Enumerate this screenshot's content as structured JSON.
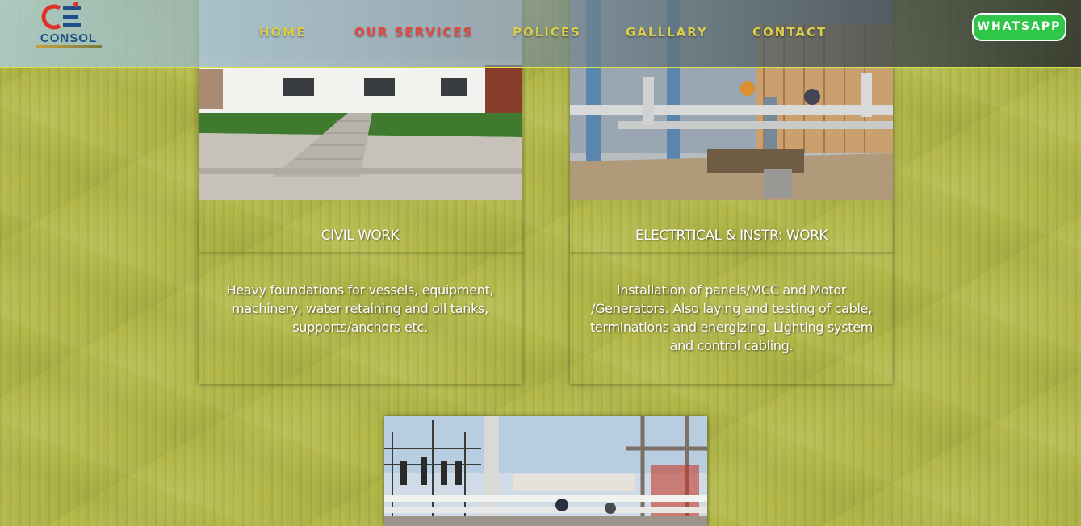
{
  "header": {
    "logo_text": "CONSOL",
    "nav": [
      {
        "label": "HOME",
        "active": false
      },
      {
        "label": "OUR SERVICES",
        "active": true
      },
      {
        "label": "POLICES",
        "active": false
      },
      {
        "label": "GALLLARY",
        "active": false
      },
      {
        "label": "CONTACT",
        "active": false
      }
    ],
    "whatsapp_label": "WHATSAPP"
  },
  "services": [
    {
      "title": "CIVIL WORK",
      "description": "Heavy foundations for vessels, equipment, machinery, water retaining and oil tanks, supports/anchors etc."
    },
    {
      "title": "ELECTRTICAL & INSTR: WORK",
      "description": "Installation of panels/MCC and Motor /Generators. Also laying and testing of cable, terminations and energizing. Lighting system and control cabling."
    }
  ],
  "colors": {
    "page_bg": "#b3b847",
    "nav_text": "#dccd4a",
    "nav_active": "#e8463d",
    "whatsapp_bg": "#2fc64a"
  }
}
